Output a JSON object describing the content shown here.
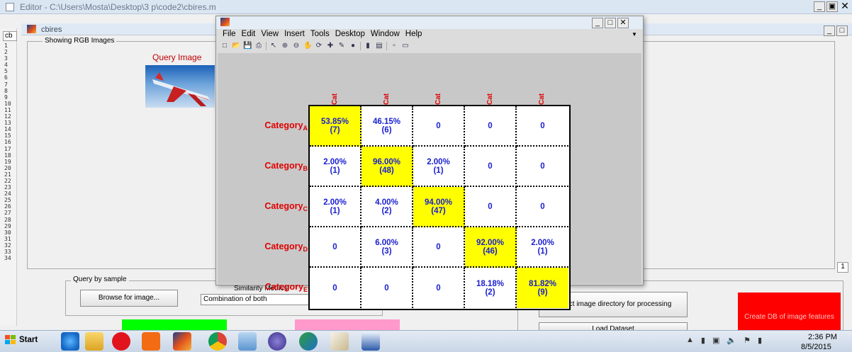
{
  "editor": {
    "title": "Editor - C:\\Users\\Mosta\\Desktop\\3 p\\code2\\cbires.m",
    "tab_label": "cb",
    "line_numbers": [
      "1",
      "2",
      "3",
      "4",
      "5",
      "6",
      "7",
      "8",
      "9",
      "10",
      "11",
      "12",
      "13",
      "14",
      "15",
      "16",
      "17",
      "18",
      "19",
      "20",
      "21",
      "22",
      "23",
      "24",
      "25",
      "26",
      "27",
      "28",
      "29",
      "30",
      "31",
      "32",
      "33",
      "34"
    ]
  },
  "cbires": {
    "title": "cbires",
    "rgb_group_label": "Showing RGB Images",
    "query_image_label": "Query Image",
    "query_by_sample_label": "Query by sample",
    "browse_button": "Browse for image...",
    "similarity_label": "Similarity Metrics",
    "similarity_selected": "Combination of both",
    "select_dir_button": "Select image directory for processing",
    "load_button": "Load Dataset",
    "create_db_button": "Create DB of image features",
    "scroll_page": "1"
  },
  "figure": {
    "menu": [
      "File",
      "Edit",
      "View",
      "Insert",
      "Tools",
      "Desktop",
      "Window",
      "Help"
    ],
    "toolbar_icons": [
      "new-figure-icon",
      "open-icon",
      "save-icon",
      "print-icon",
      "select-arrow-icon",
      "zoom-in-icon",
      "zoom-out-icon",
      "pan-icon",
      "rotate-icon",
      "data-cursor-icon",
      "brush-icon",
      "link-icon",
      "colorbar-icon",
      "legend-icon",
      "hide-plot-tools-icon",
      "show-plot-tools-icon"
    ]
  },
  "chart_data": {
    "type": "table",
    "column_labels": [
      "Cate",
      "Cate",
      "Cate",
      "Cate",
      "Cate"
    ],
    "rows": [
      {
        "label": "Category",
        "sub": "A",
        "cells": [
          {
            "pct": "53.85%",
            "n": "(7)",
            "hi": true
          },
          {
            "pct": "46.15%",
            "n": "(6)"
          },
          {
            "pct": "0",
            "n": ""
          },
          {
            "pct": "0",
            "n": ""
          },
          {
            "pct": "0",
            "n": ""
          }
        ]
      },
      {
        "label": "Category",
        "sub": "B",
        "cells": [
          {
            "pct": "2.00%",
            "n": "(1)"
          },
          {
            "pct": "96.00%",
            "n": "(48)",
            "hi": true
          },
          {
            "pct": "2.00%",
            "n": "(1)"
          },
          {
            "pct": "0",
            "n": ""
          },
          {
            "pct": "0",
            "n": ""
          }
        ]
      },
      {
        "label": "Category",
        "sub": "C",
        "cells": [
          {
            "pct": "2.00%",
            "n": "(1)"
          },
          {
            "pct": "4.00%",
            "n": "(2)"
          },
          {
            "pct": "94.00%",
            "n": "(47)",
            "hi": true
          },
          {
            "pct": "0",
            "n": ""
          },
          {
            "pct": "0",
            "n": ""
          }
        ]
      },
      {
        "label": "Category",
        "sub": "D",
        "cells": [
          {
            "pct": "0",
            "n": ""
          },
          {
            "pct": "6.00%",
            "n": "(3)"
          },
          {
            "pct": "0",
            "n": ""
          },
          {
            "pct": "92.00%",
            "n": "(46)",
            "hi": true
          },
          {
            "pct": "2.00%",
            "n": "(1)"
          }
        ]
      },
      {
        "label": "Category",
        "sub": "E",
        "cells": [
          {
            "pct": "0",
            "n": ""
          },
          {
            "pct": "0",
            "n": ""
          },
          {
            "pct": "0",
            "n": ""
          },
          {
            "pct": "18.18%",
            "n": "(2)"
          },
          {
            "pct": "81.82%",
            "n": "(9)",
            "hi": true
          }
        ]
      }
    ]
  },
  "taskbar": {
    "start_label": "Start",
    "time": "2:36 PM",
    "date": "8/5/2015"
  }
}
